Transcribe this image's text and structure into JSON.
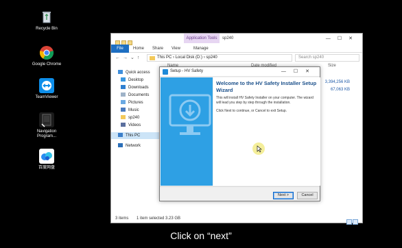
{
  "desktop": {
    "icons": [
      {
        "label": "Recycle Bin",
        "icon": "recycle-bin-icon"
      },
      {
        "label": "Google Chrome",
        "icon": "chrome-icon"
      },
      {
        "label": "TeamViewer",
        "icon": "teamviewer-icon"
      },
      {
        "label": "Navigation Program...",
        "icon": "navigation-program-icon"
      },
      {
        "label": "百度网盘",
        "icon": "baidu-netdisk-icon"
      }
    ]
  },
  "explorer": {
    "title": "sp240",
    "app_tools": "Application Tools",
    "tabs": [
      "File",
      "Home",
      "Share",
      "View",
      "Manage"
    ],
    "breadcrumb": [
      "This PC",
      "Local Disk (D:)",
      "sp240"
    ],
    "search_placeholder": "Search sp240",
    "columns": {
      "name": "Name",
      "date": "Date modified",
      "size": "Size"
    },
    "sizes": [
      "3,394,256 KB",
      "67,063 KB"
    ],
    "nav": [
      {
        "label": "Quick access",
        "icon": "star-icon"
      },
      {
        "label": "Desktop",
        "icon": "desktop-icon"
      },
      {
        "label": "Downloads",
        "icon": "download-icon"
      },
      {
        "label": "Documents",
        "icon": "document-icon"
      },
      {
        "label": "Pictures",
        "icon": "picture-icon"
      },
      {
        "label": "Music",
        "icon": "music-icon"
      },
      {
        "label": "sp240",
        "icon": "folder-icon"
      },
      {
        "label": "Videos",
        "icon": "video-icon"
      },
      {
        "label": "This PC",
        "icon": "computer-icon"
      },
      {
        "label": "Network",
        "icon": "network-icon"
      }
    ],
    "status": {
      "items": "3 items",
      "selected": "1 item selected 3.23 GB"
    }
  },
  "setup": {
    "title": "Setup - HV Safety",
    "heading": "Welcome to the HV Safety Installer Setup Wizard",
    "text1": "This will install HV Safety Installer on your computer. The wizard will lead you step by step through the installation.",
    "text2": "Click Next to continue, or Cancel to exit Setup.",
    "next_label": "Next >",
    "cancel_label": "Cancel"
  },
  "caption": "Click on “next”",
  "colors": {
    "accent": "#1e6fc2",
    "wizard_side": "#2ea0e4",
    "heading": "#1a4f8a"
  }
}
